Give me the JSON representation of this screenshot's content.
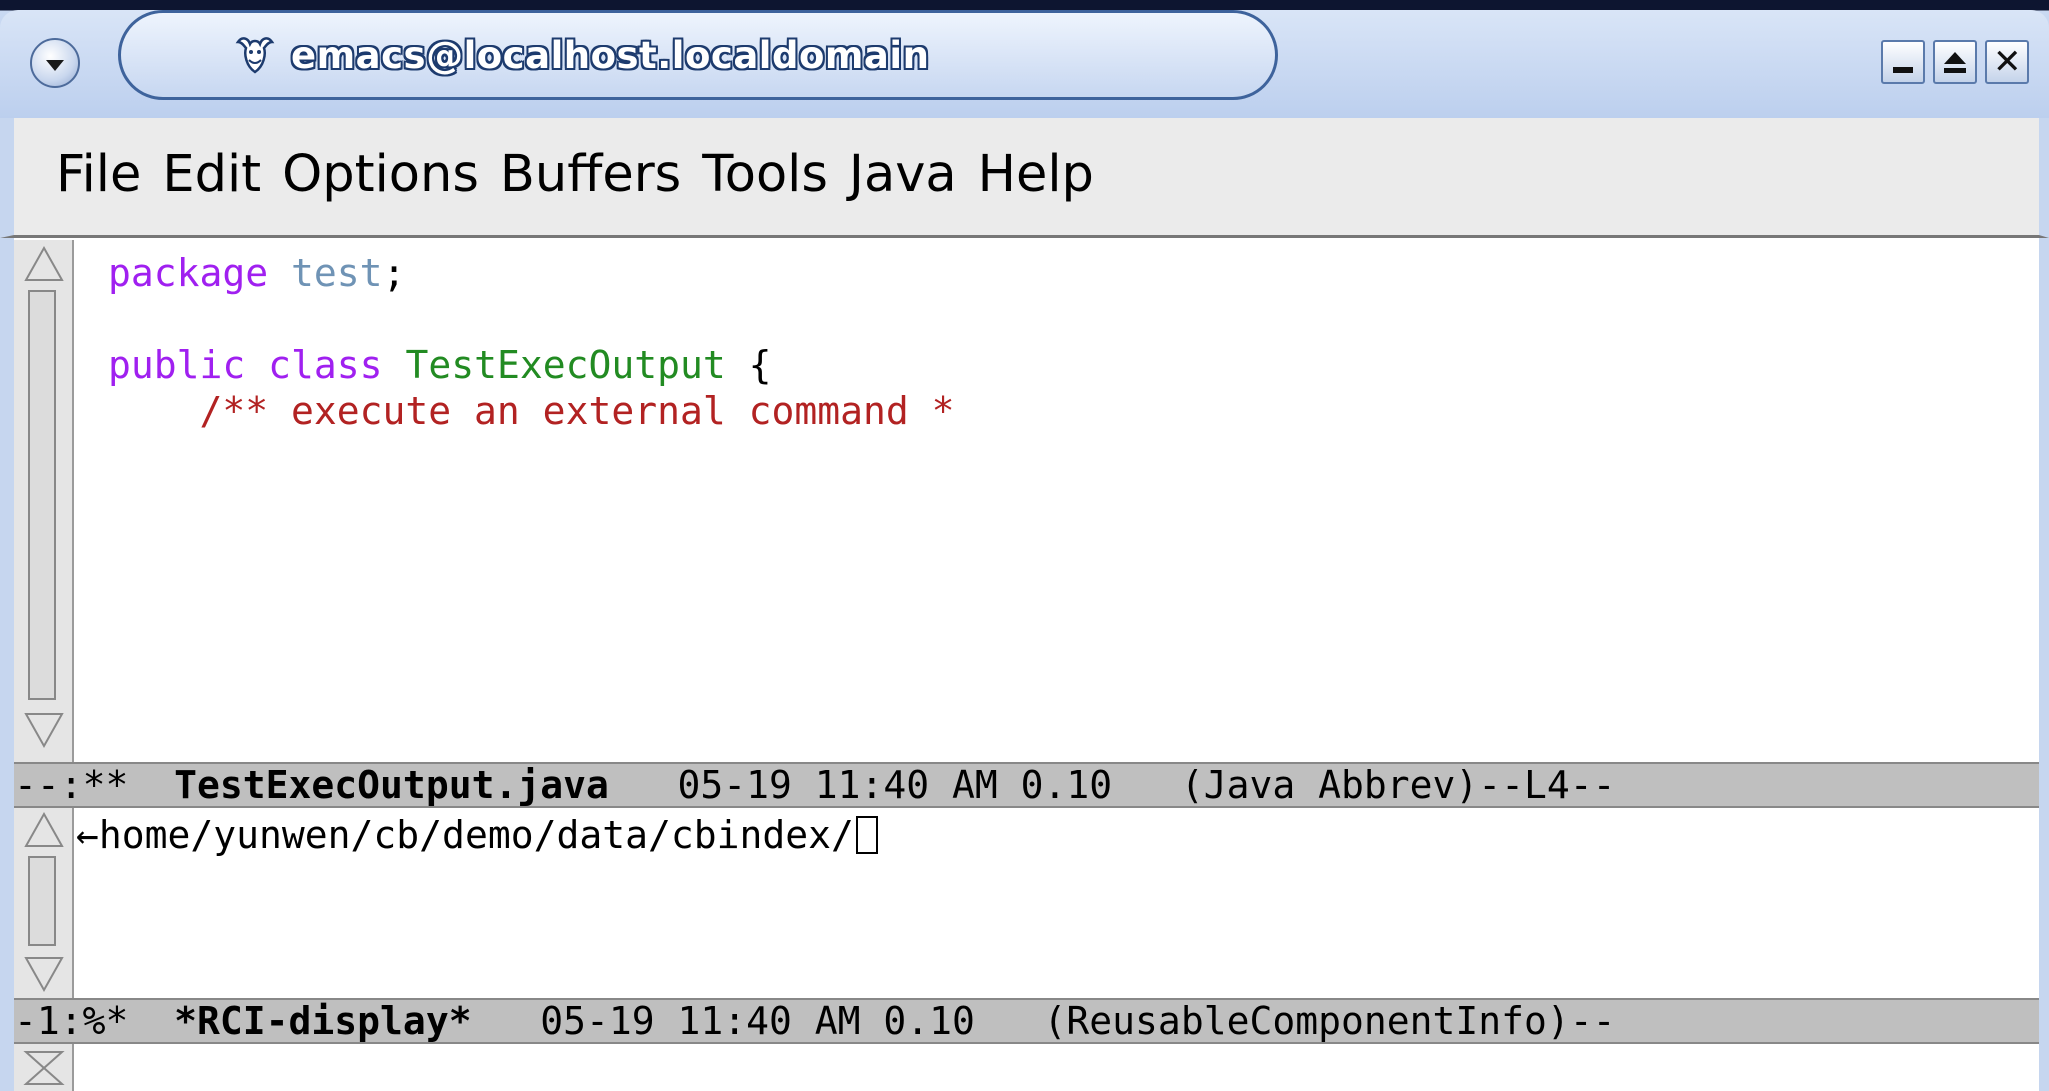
{
  "window": {
    "title": "emacs@localhost.localdomain"
  },
  "menubar": {
    "items": [
      "File",
      "Edit",
      "Options",
      "Buffers",
      "Tools",
      "Java",
      "Help"
    ]
  },
  "buffer1": {
    "line1": {
      "kw": "package",
      "name": "test",
      "punct": ";"
    },
    "line2": {
      "kw1": "public",
      "kw2": "class",
      "type": "TestExecOutput",
      "brace": "{"
    },
    "line3": {
      "comment": "/** execute an external command *"
    }
  },
  "modeline1": {
    "status": "--:**",
    "buffer_name": "TestExecOutput.java",
    "time": "05-19 11:40 AM 0.10",
    "mode": "(Java Abbrev)--L4--"
  },
  "minibuffer": {
    "path": "home/yunwen/cb/demo/data/cbindex/"
  },
  "modeline2": {
    "status": "-1:%*",
    "buffer_name": "*RCI-display*",
    "time": "05-19 11:40 AM 0.10",
    "mode": "(ReusableComponentInfo)--"
  },
  "colors": {
    "keyword": "#a020f0",
    "package_name": "#6f93b5",
    "type": "#228b22",
    "comment": "#b22222",
    "modeline_bg": "#bfbfbf",
    "titlebar": "#c6d6ef"
  }
}
